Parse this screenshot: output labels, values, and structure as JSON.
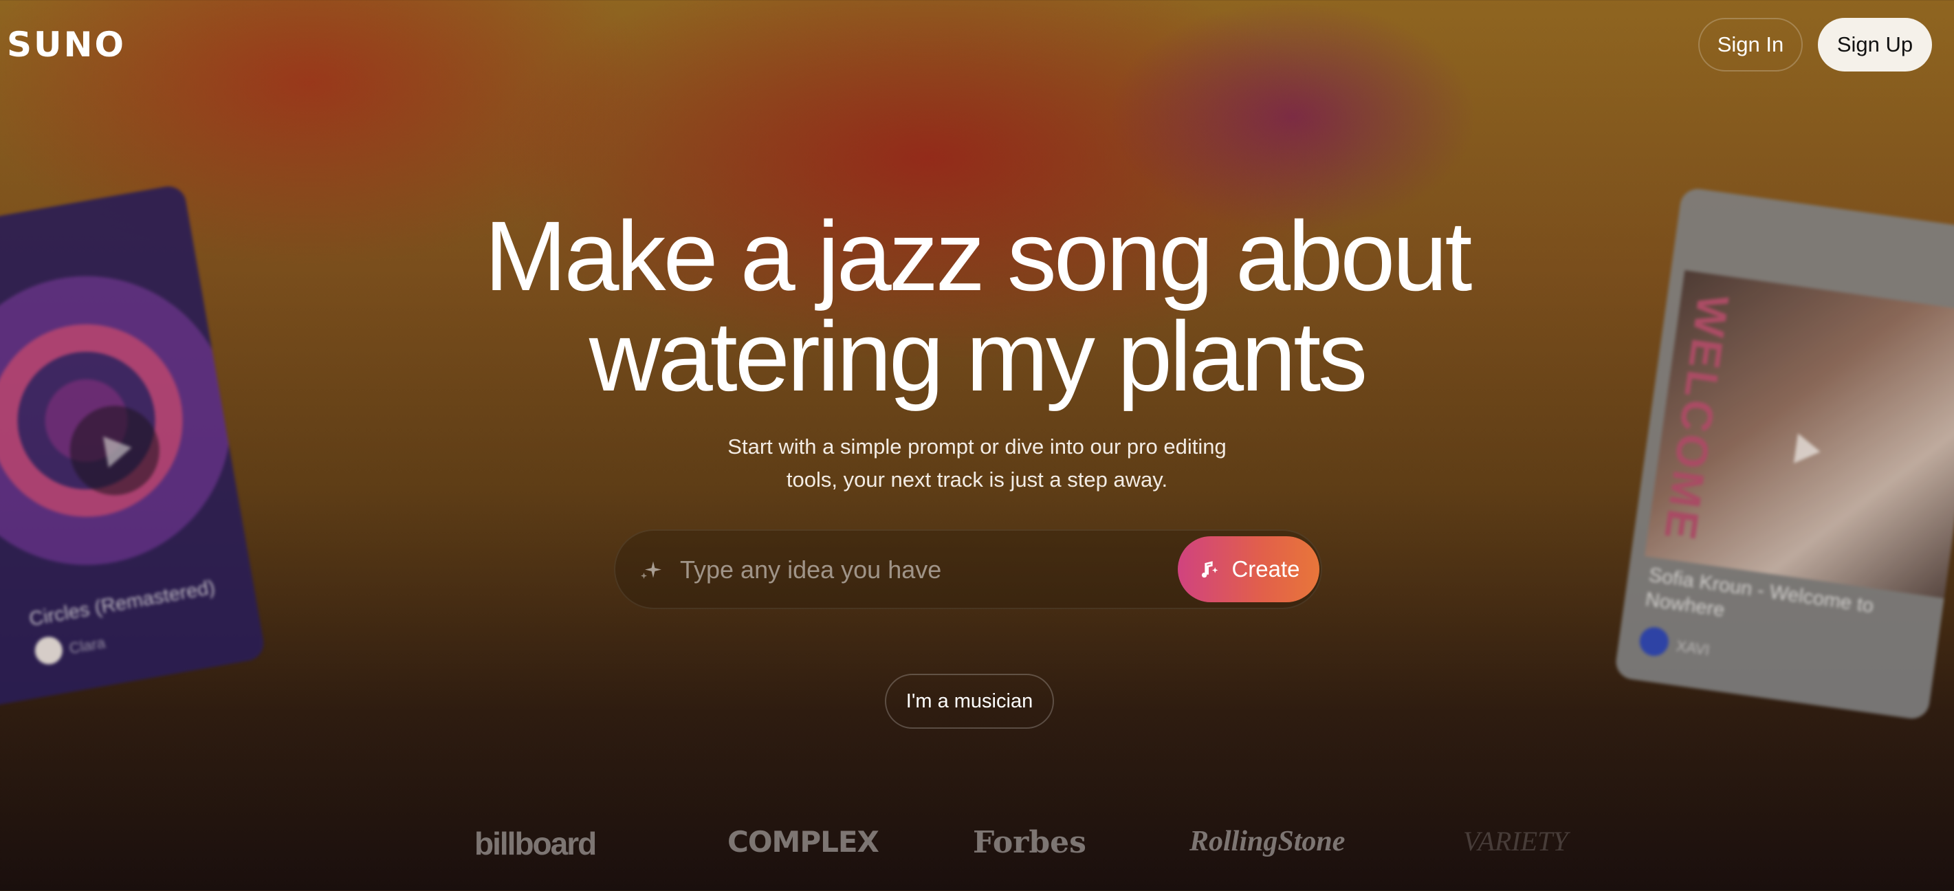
{
  "header": {
    "logo": "SUNO",
    "sign_in_label": "Sign In",
    "sign_up_label": "Sign Up"
  },
  "hero": {
    "title_line1": "Make a jazz song about",
    "title_line2": "watering my plants",
    "subtitle_line1": "Start with a simple prompt or dive into our pro editing",
    "subtitle_line2": "tools, your next track is just a step away."
  },
  "prompt": {
    "placeholder": "Type any idea you have",
    "value": "",
    "create_label": "Create"
  },
  "musician_button_label": "I'm a musician",
  "cards": [
    {
      "title": "Circles (Remastered)",
      "artist": "Clara"
    },
    {
      "title": "Sofia Kroun - Welcome to Nowhere",
      "artist": "XAVI",
      "art_text": "WELCOME"
    }
  ],
  "press": [
    "billboard",
    "COMPLEX",
    "Forbes",
    "RollingStone",
    "VARIETY"
  ],
  "colors": {
    "create_gradient_start": "#d0437f",
    "create_gradient_end": "#e8763a",
    "sign_up_bg": "#f5f1ea"
  },
  "icons": [
    "sparkle-icon",
    "music-note-sparkle-icon",
    "play-icon"
  ]
}
